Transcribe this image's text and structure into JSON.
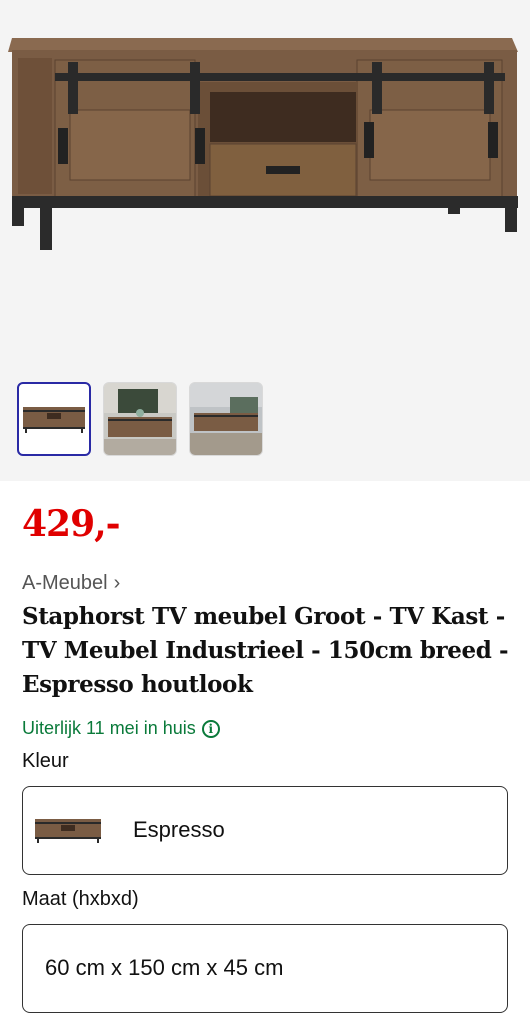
{
  "gallery": {
    "main_image_alt": "",
    "thumbnails": [
      {
        "name": "product-thumbnail-1",
        "active": true
      },
      {
        "name": "product-thumbnail-2",
        "active": false
      },
      {
        "name": "product-thumbnail-3",
        "active": false
      }
    ]
  },
  "product": {
    "price": "429,-",
    "brand": "A-Meubel",
    "brand_chevron": "›",
    "title": "Staphorst TV meubel Groot - TV Kast - TV Meubel Industrieel - 150cm breed - Espresso houtlook",
    "delivery": "Uiterlijk 11 mei in huis",
    "info_icon": "i"
  },
  "options": {
    "color_label": "Kleur",
    "color_value": "Espresso",
    "size_label": "Maat (hxbxd)",
    "size_value": "60 cm x 150 cm x 45 cm"
  },
  "colors": {
    "price": "#e00000",
    "delivery": "#0a7a3a",
    "active_thumb_border": "#2a2aa5"
  }
}
